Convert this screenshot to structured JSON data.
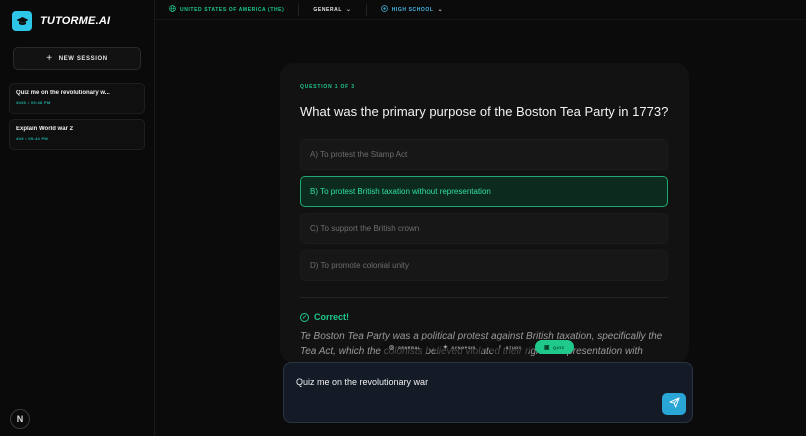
{
  "brand": {
    "name": "TUTORME.AI"
  },
  "sidebar": {
    "new_session_label": "NEW SESSION",
    "sessions": [
      {
        "title": "Quiz me on the revolutionary w...",
        "time": "3h50 • 09:48 PM"
      },
      {
        "title": "Explain World war 2",
        "time": "4h9 • 09:44 PM"
      }
    ],
    "user_initial": "N"
  },
  "topbar": {
    "country": "UNITED STATES OF AMERICA (THE)",
    "subject": "GENERAL",
    "level": "HIGH SCHOOL"
  },
  "quiz": {
    "counter": "QUESTION 1 OF 3",
    "question": "What was the primary purpose of the Boston Tea Party in 1773?",
    "options": [
      {
        "label": "A) To protest the Stamp Act",
        "selected": false
      },
      {
        "label": "B) To protest British taxation without representation",
        "selected": true
      },
      {
        "label": "C) To support the British crown",
        "selected": false
      },
      {
        "label": "D) To promote colonial unity",
        "selected": false
      }
    ],
    "result": "Correct!",
    "explanation": "Te Boston Tea Party was a political protest against British taxation, specifically the Tea Act, which the colonists believed violated their right to representation with"
  },
  "modes": {
    "general": "GENERAL",
    "synopsis": "SYNOPSIS",
    "study": "STUDY",
    "quiz": "QUIZ"
  },
  "input": {
    "value": "Quiz me on the revolutionary war"
  },
  "colors": {
    "accent": "#1ec98b",
    "brand": "#2ec6e6",
    "send": "#2aa6d6"
  }
}
